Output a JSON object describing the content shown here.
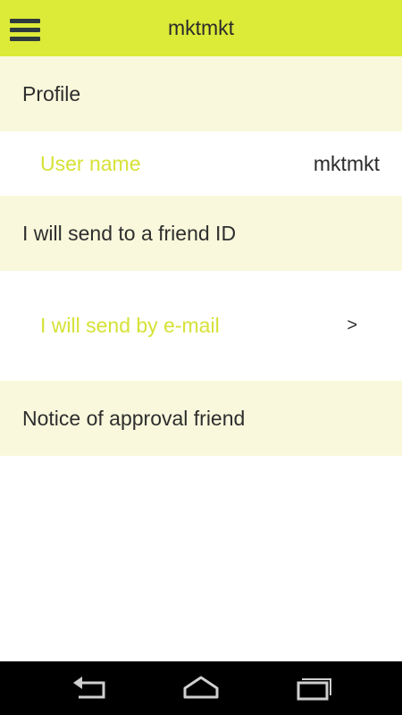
{
  "header": {
    "title": "mktmkt"
  },
  "profile_section": {
    "title": "Profile",
    "user_name_label": "User name",
    "user_name_value": "mktmkt"
  },
  "friend_id_section": {
    "title": "I will send to a friend ID",
    "email_label": "I will send by e-mail",
    "email_chevron": ">"
  },
  "approval_section": {
    "title": "Notice of approval friend"
  },
  "nav_bar": {
    "buttons": [
      "back-icon",
      "home-icon",
      "recent-apps-icon"
    ]
  },
  "colors": {
    "accent": "#dcea38",
    "accent_text": "#d6e236",
    "section_bg": "#f9f8dc"
  }
}
